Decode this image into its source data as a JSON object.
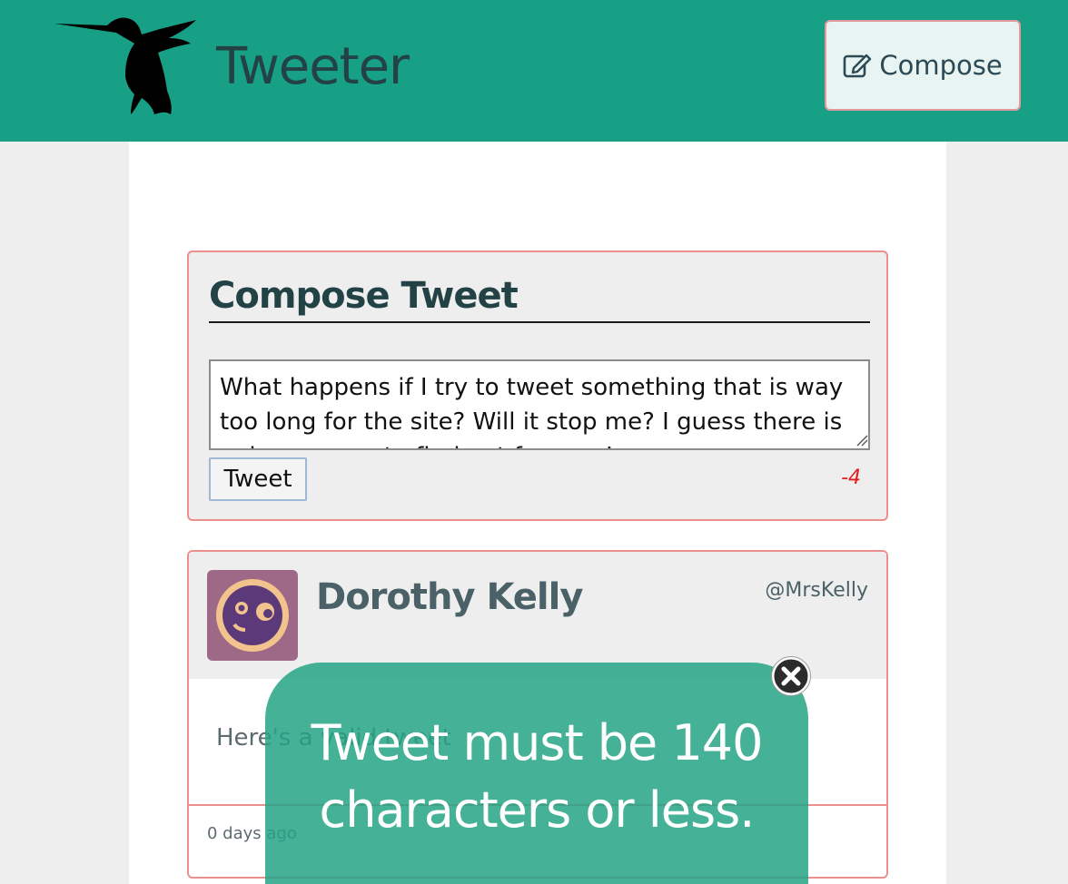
{
  "header": {
    "brand": "Tweeter",
    "compose_label": "Compose",
    "logo_icon": "hummingbird-icon",
    "compose_icon": "edit-icon",
    "brand_color": "#18a086"
  },
  "composer": {
    "title": "Compose Tweet",
    "text_value": "What happens if I try to tweet something that is way too long for the site? Will it stop me? I guess there is only one way to find out for sure!",
    "submit_label": "Tweet",
    "char_counter": "-4",
    "counter_color": "#e01d1d"
  },
  "tweets": [
    {
      "author": "Dorothy Kelly",
      "handle": "@MrsKelly",
      "text": "Here's a valid tweet",
      "time": "0 days ago"
    }
  ],
  "error_toast": {
    "message": "Tweet must be 140 characters or less.",
    "close_icon": "close-icon"
  }
}
